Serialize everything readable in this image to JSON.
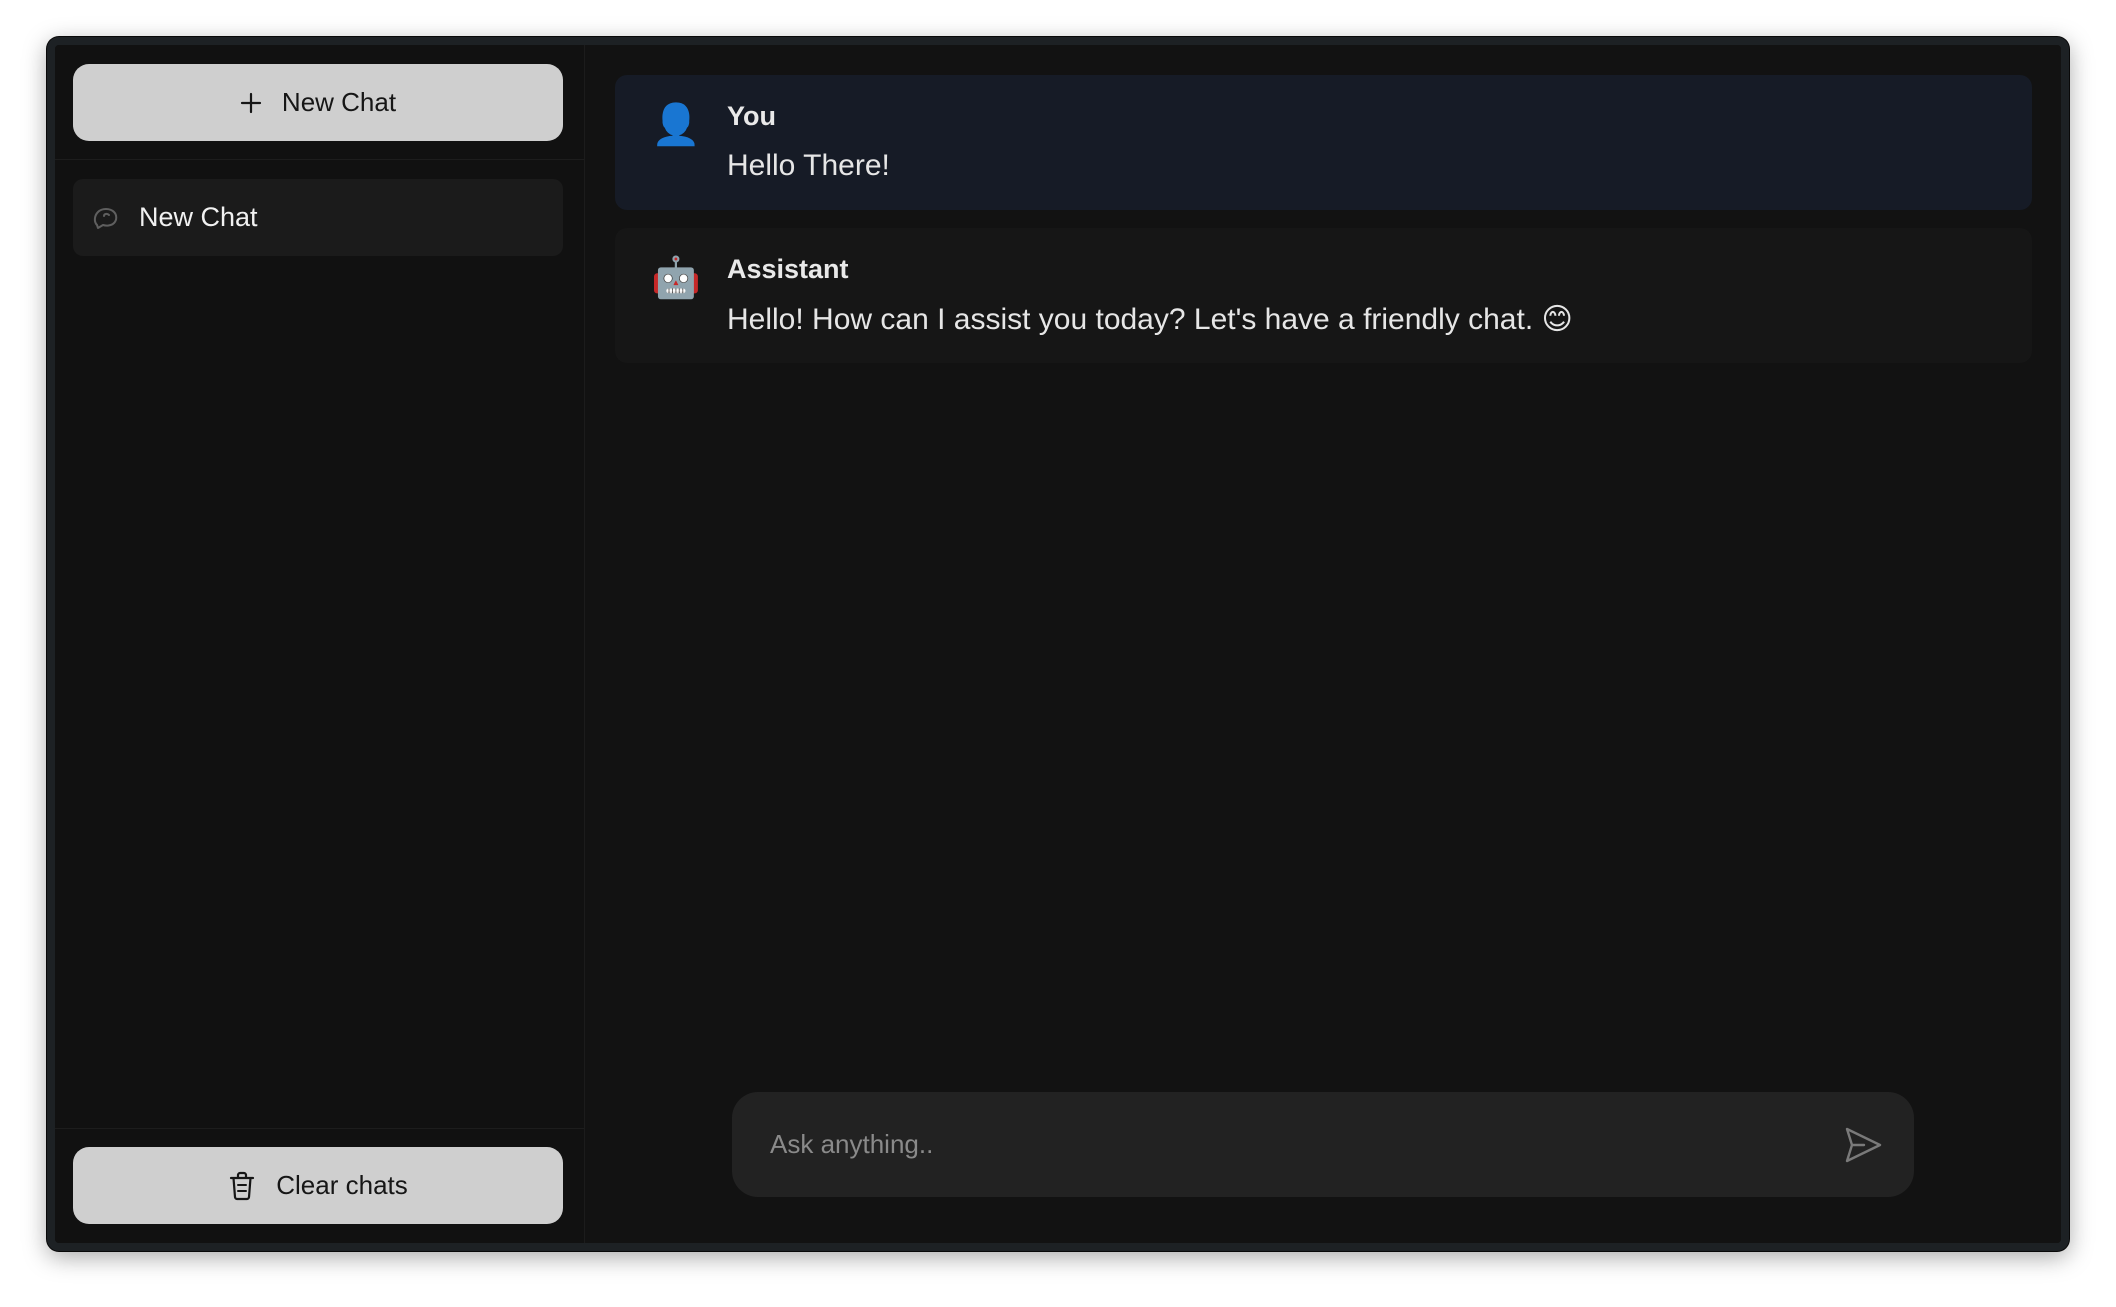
{
  "sidebar": {
    "new_chat_button": {
      "label": "New Chat",
      "icon": "plus-icon"
    },
    "chats": [
      {
        "label": "New Chat",
        "icon": "chat-bubble-icon"
      }
    ],
    "clear_button": {
      "label": "Clear chats",
      "icon": "trash-icon"
    }
  },
  "messages": [
    {
      "role_label": "You",
      "avatar": "👤",
      "avatar_icon": "user-icon",
      "text": "Hello There!"
    },
    {
      "role_label": "Assistant",
      "avatar": "🤖",
      "avatar_icon": "robot-icon",
      "text": "Hello! How can I assist you today? Let's have a friendly chat. 😊"
    }
  ],
  "composer": {
    "placeholder": "Ask anything..",
    "value": "",
    "send_icon": "send-icon"
  },
  "colors": {
    "window_bg": "#121212",
    "user_message_bg": "#161b26",
    "assistant_message_bg": "#161616",
    "button_bg": "#cfcfcf",
    "composer_bg": "#222222"
  }
}
